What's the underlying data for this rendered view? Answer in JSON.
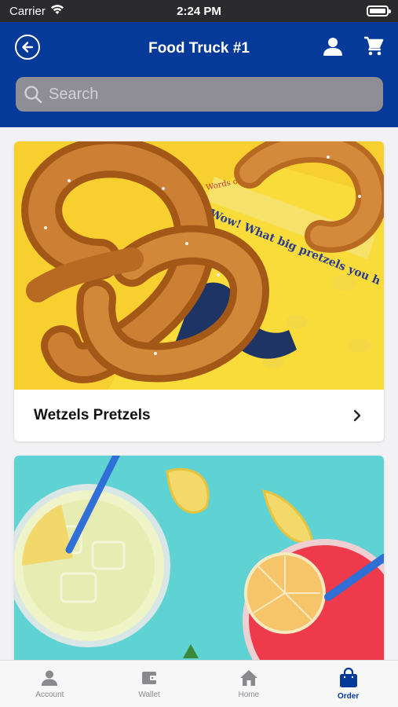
{
  "status_bar": {
    "carrier": "Carrier",
    "time": "2:24 PM"
  },
  "header": {
    "title": "Food Truck #1",
    "back_icon": "back-arrow-circle-icon",
    "profile_icon": "person-icon",
    "cart_icon": "cart-icon",
    "background_color": "#053a9a"
  },
  "search": {
    "placeholder": "Search",
    "value": ""
  },
  "cards": [
    {
      "title": "Wetzels Pretzels",
      "image": "pretzels-photo"
    },
    {
      "title": "",
      "image": "lemonade-photo"
    }
  ],
  "tab_bar": {
    "items": [
      {
        "label": "Account",
        "icon": "person-icon",
        "active": false
      },
      {
        "label": "Wallet",
        "icon": "wallet-icon",
        "active": false
      },
      {
        "label": "Home",
        "icon": "home-icon",
        "active": false
      },
      {
        "label": "Order",
        "icon": "shopping-bag-icon",
        "active": true
      }
    ],
    "active_color": "#053a9a",
    "inactive_color": "#8a8a8e"
  }
}
